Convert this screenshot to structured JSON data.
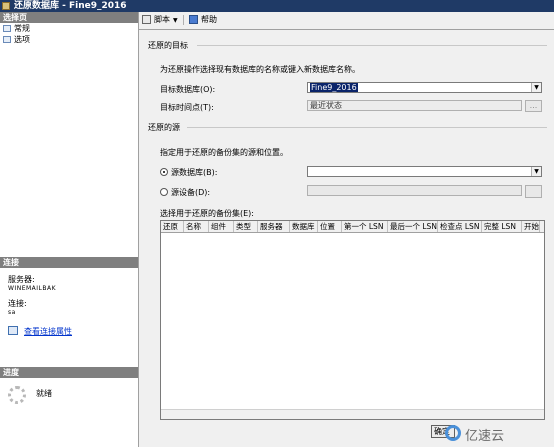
{
  "window": {
    "title": "还原数据库 - Fine9_2016"
  },
  "left": {
    "pages_header": "选择页",
    "pages": [
      "常规",
      "选项"
    ],
    "connection_header": "连接",
    "server_label": "服务器:",
    "server_value": "WINEMAILBAK",
    "connection_label": "连接:",
    "connection_value": "sa",
    "view_conn_link": "查看连接属性",
    "progress_header": "进度",
    "progress_status": "就绪"
  },
  "toolbar": {
    "script_label": "脚本",
    "help_label": "帮助"
  },
  "target": {
    "group_title": "还原的目标",
    "instruction": "为还原操作选择现有数据库的名称或键入新数据库名称。",
    "db_label": "目标数据库(O):",
    "db_value": "Fine9_2016",
    "time_label": "目标时间点(T):",
    "time_value": "最近状态",
    "time_button": "..."
  },
  "source": {
    "group_title": "还原的源",
    "instruction": "指定用于还原的备份集的源和位置。",
    "from_db_label": "源数据库(B):",
    "from_device_label": "源设备(D):",
    "device_button": "",
    "backupsets_label": "选择用于还原的备份集(E):"
  },
  "grid": {
    "columns": [
      "还原",
      "名称",
      "组件",
      "类型",
      "服务器",
      "数据库",
      "位置",
      "第一个 LSN",
      "最后一个 LSN",
      "检查点 LSN",
      "完整 LSN",
      "开始"
    ]
  },
  "buttons": {
    "ok": "确定"
  },
  "watermark": {
    "text": "亿速云"
  },
  "colors": {
    "titlebar": "#1f3a66",
    "link": "#0033cc",
    "section_header": "#7f7f7f"
  }
}
